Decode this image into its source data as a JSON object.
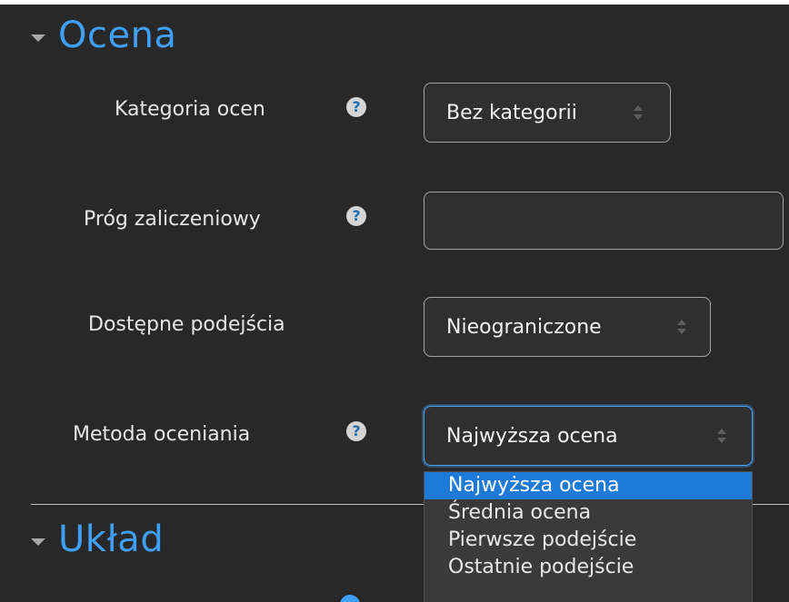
{
  "sections": {
    "grade": {
      "title": "Ocena"
    },
    "layout": {
      "title": "Układ"
    }
  },
  "fields": {
    "grade_category": {
      "label": "Kategoria ocen",
      "value": "Bez kategorii"
    },
    "grade_to_pass": {
      "label": "Próg zaliczeniowy",
      "value": ""
    },
    "attempts_allowed": {
      "label": "Dostępne podejścia",
      "value": "Nieograniczone"
    },
    "grading_method": {
      "label": "Metoda oceniania",
      "value": "Najwyższa ocena",
      "options": [
        "Najwyższa ocena",
        "Średnia ocena",
        "Pierwsze podejście",
        "Ostatnie podejście"
      ]
    }
  },
  "help": {
    "glyph": "?"
  },
  "colors": {
    "accent": "#3f9ff7",
    "panel_bg": "#282828",
    "selected_option": "#1e7ad8"
  }
}
